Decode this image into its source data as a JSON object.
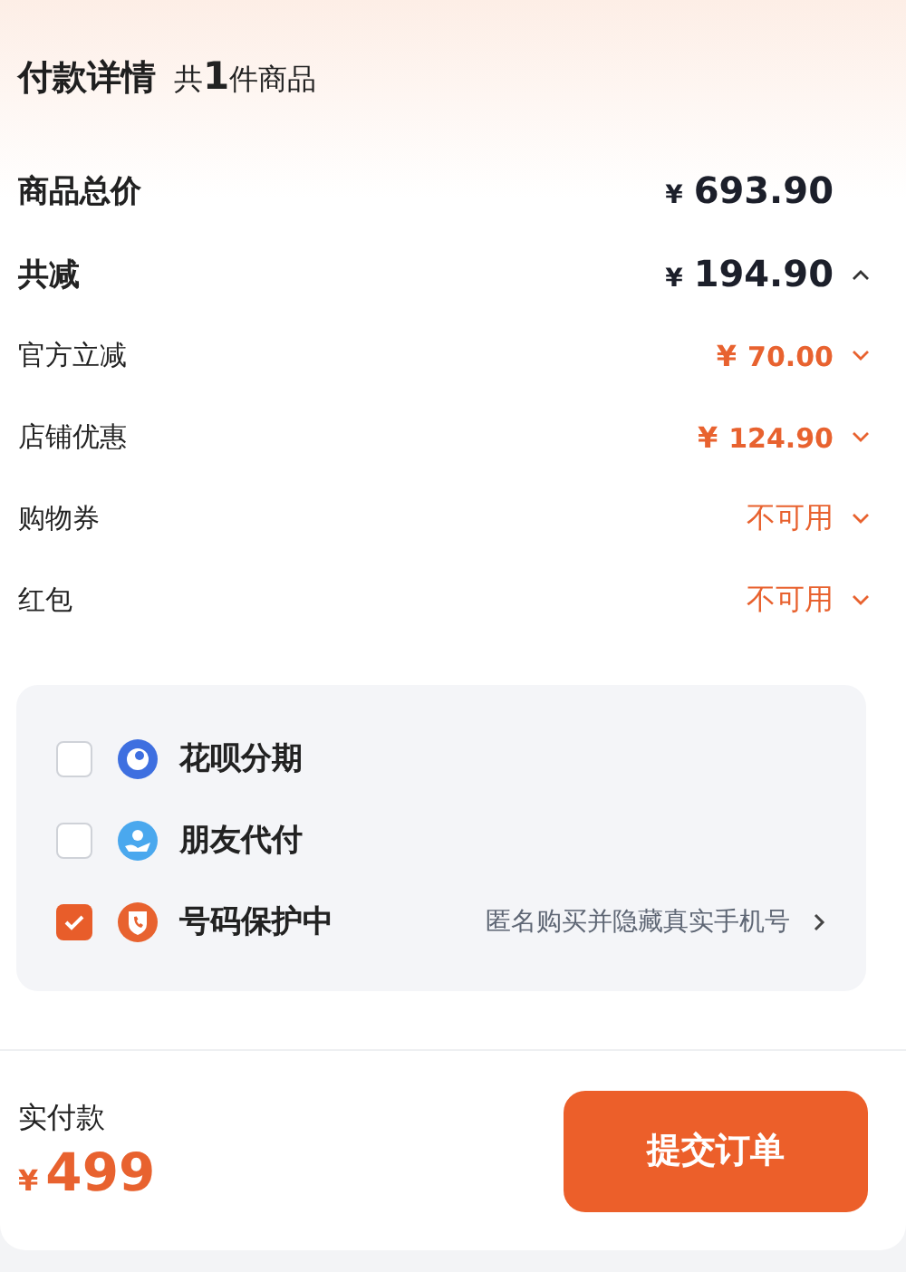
{
  "header": {
    "title": "付款详情",
    "count": "共**1**件商品"
  },
  "rows": [
    {
      "kind": "main",
      "label": "商品总价",
      "currency": "¥",
      "amount": "693.90"
    },
    {
      "kind": "main",
      "label": "共减",
      "currency": "¥",
      "amount": "194.90",
      "expanded": true
    },
    {
      "kind": "detail",
      "label": "官方立减",
      "currency": "¥",
      "amount": "70.00",
      "expanded": false
    },
    {
      "kind": "detail",
      "label": "店铺优惠",
      "currency": "¥",
      "amount": "124.90",
      "expanded": false
    },
    {
      "kind": "detail",
      "label": "购物券",
      "amount": "不可用",
      "expanded": false
    },
    {
      "kind": "detail",
      "label": "红包",
      "amount": "不可用",
      "expanded": false
    }
  ],
  "options": [
    {
      "kind": "installment",
      "label": "花呗分期",
      "checked": false
    },
    {
      "kind": "friend",
      "label": "朋友代付",
      "checked": false
    },
    {
      "kind": "phone",
      "label": "号码保护中",
      "checked": true,
      "note": "匿名购买并隐藏真实手机号"
    }
  ],
  "footer": {
    "label": "实付款",
    "currency": "¥",
    "amount": "499",
    "button": "提交订单"
  }
}
